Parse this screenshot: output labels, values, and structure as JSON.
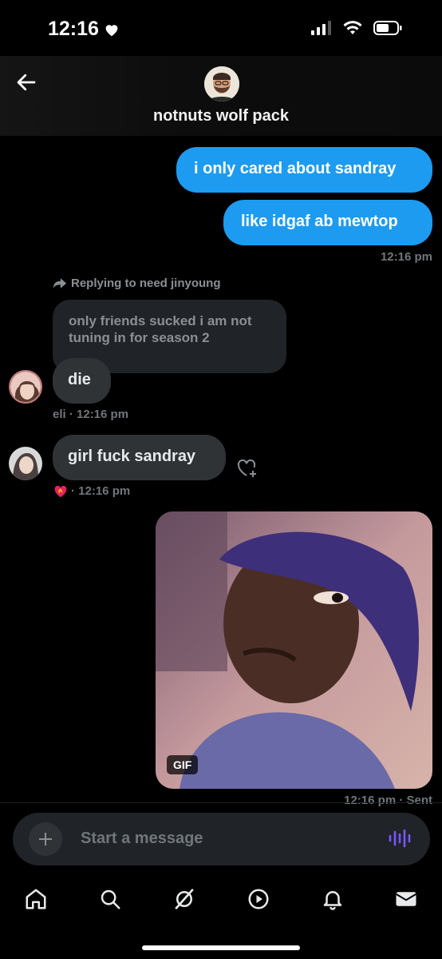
{
  "status": {
    "time": "12:16"
  },
  "header": {
    "title": "notnuts wolf pack"
  },
  "messages": {
    "out1": "i only cared about sandray",
    "out2": "like idgaf ab mewtop",
    "out_time": "12:16 pm",
    "reply": {
      "label": "Replying to need jinyoung",
      "quoted_text": "only friends sucked i am not tuning in for season 2"
    },
    "in1": {
      "text": "die",
      "meta": "eli · 12:16 pm"
    },
    "in2": {
      "text": "girl fuck sandray",
      "meta": "· 12:16 pm",
      "reaction": "heart-on-fire"
    },
    "gif": {
      "badge": "GIF",
      "meta": "12:16 pm · Sent"
    }
  },
  "composer": {
    "placeholder": "Start a message"
  },
  "colors": {
    "accent": "#1d9bf0",
    "incoming": "#2f3336",
    "voice": "#7856ff"
  },
  "tabbar": [
    "home-icon",
    "search-icon",
    "grok-icon",
    "video-icon",
    "bell-icon",
    "mail-icon"
  ]
}
